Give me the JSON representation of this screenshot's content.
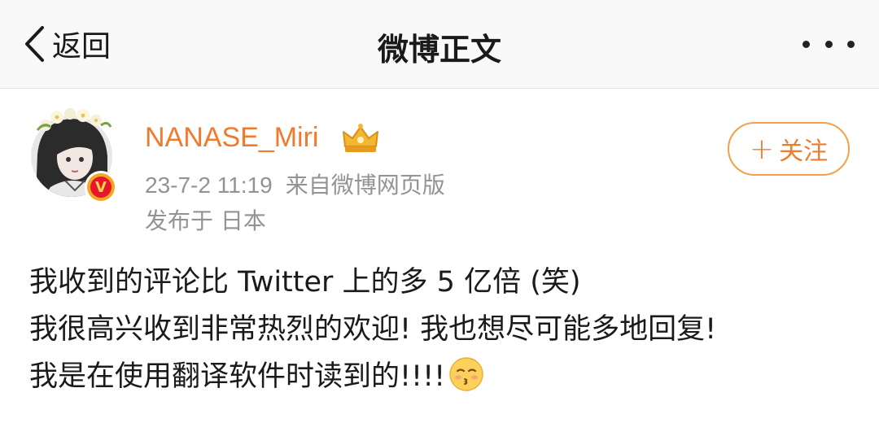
{
  "nav": {
    "back_label": "返回",
    "title": "微博正文",
    "more_icon": "more-dots-icon"
  },
  "author": {
    "name": "NANASE_Miri",
    "crown_icon": "vip-crown-icon",
    "verify_badge": "V",
    "time": "23-7-2 11:19",
    "source": "来自微博网页版",
    "location": "发布于 日本",
    "follow_plus": "+",
    "follow_label": "关注"
  },
  "post": {
    "lines": [
      "我收到的评论比 Twitter 上的多 5 亿倍 (笑)",
      "我很高兴收到非常热烈的欢迎! 我也想尽可能多地回复!",
      "我是在使用翻译软件时读到的!!!!"
    ],
    "emoji_icon": "kissing-face-emoji"
  },
  "colors": {
    "accent": "#f07b2d",
    "follow_border": "#f3a04a",
    "meta_gray": "#939393",
    "navbar_bg": "#f9f9f9"
  }
}
